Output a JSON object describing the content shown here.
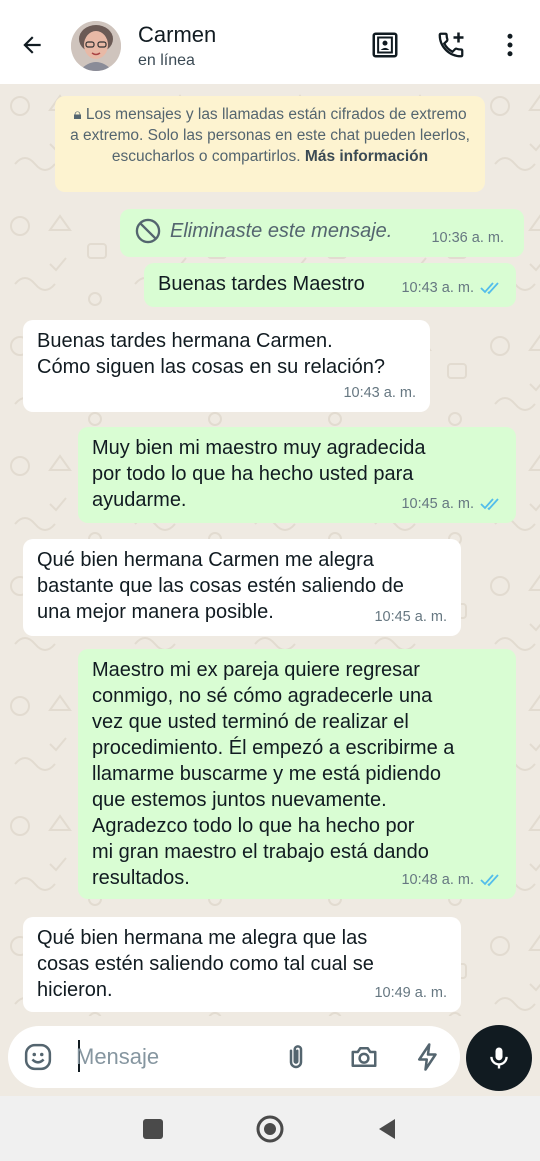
{
  "header": {
    "name": "Carmen",
    "status": "en línea"
  },
  "notice": {
    "text": "Los mensajes y las llamadas están cifrados de extremo a extremo. Solo las personas en este chat pueden leerlos, escucharlos o compartirlos.",
    "link": "Más información"
  },
  "messages": [
    {
      "direction": "out",
      "deleted": true,
      "text": "Eliminaste este mensaje.",
      "time": "10:36 a. m."
    },
    {
      "direction": "out",
      "text": "Buenas tardes Maestro",
      "time": "10:43 a. m.",
      "read": true
    },
    {
      "direction": "in",
      "text": "Buenas tardes hermana Carmen.\nCómo siguen las cosas en su relación?",
      "time": "10:43 a. m."
    },
    {
      "direction": "out",
      "text": "Muy bien mi maestro muy agradecida\npor todo lo que ha hecho usted para\nayudarme.",
      "time": "10:45 a. m.",
      "read": true
    },
    {
      "direction": "in",
      "text": "Qué bien hermana Carmen me alegra\nbastante que las cosas estén saliendo de\nuna mejor manera posible.",
      "time": "10:45 a. m."
    },
    {
      "direction": "out",
      "text": "Maestro mi ex pareja quiere regresar\nconmigo, no sé cómo agradecerle una\nvez que usted terminó de realizar el\nprocedimiento. Él empezó a escribirme a\nllamarme buscarme y me está pidiendo\nque estemos juntos nuevamente.\nAgradezco todo lo que ha hecho por\nmi gran maestro el trabajo está dando\nresultados.",
      "time": "10:48 a. m.",
      "read": true
    },
    {
      "direction": "in",
      "text": "Qué bien hermana me alegra que las\ncosas estén saliendo como tal cual se\nhicieron.",
      "time": "10:49 a. m."
    }
  ],
  "input": {
    "placeholder": "Mensaje"
  },
  "colors": {
    "outgoing_bubble": "#d9fdd3",
    "incoming_bubble": "#ffffff",
    "read_ticks": "#53bdeb",
    "chat_background": "#efeae2",
    "notice_background": "#fdf3d0"
  },
  "icons": {
    "back": "arrow-left-icon",
    "contact_card": "contact-card-icon",
    "add_call": "phone-plus-icon",
    "menu": "more-vertical-icon",
    "emoji": "emoji-icon",
    "attach": "paperclip-icon",
    "camera": "camera-icon",
    "quick": "lightning-icon",
    "mic": "mic-icon"
  }
}
